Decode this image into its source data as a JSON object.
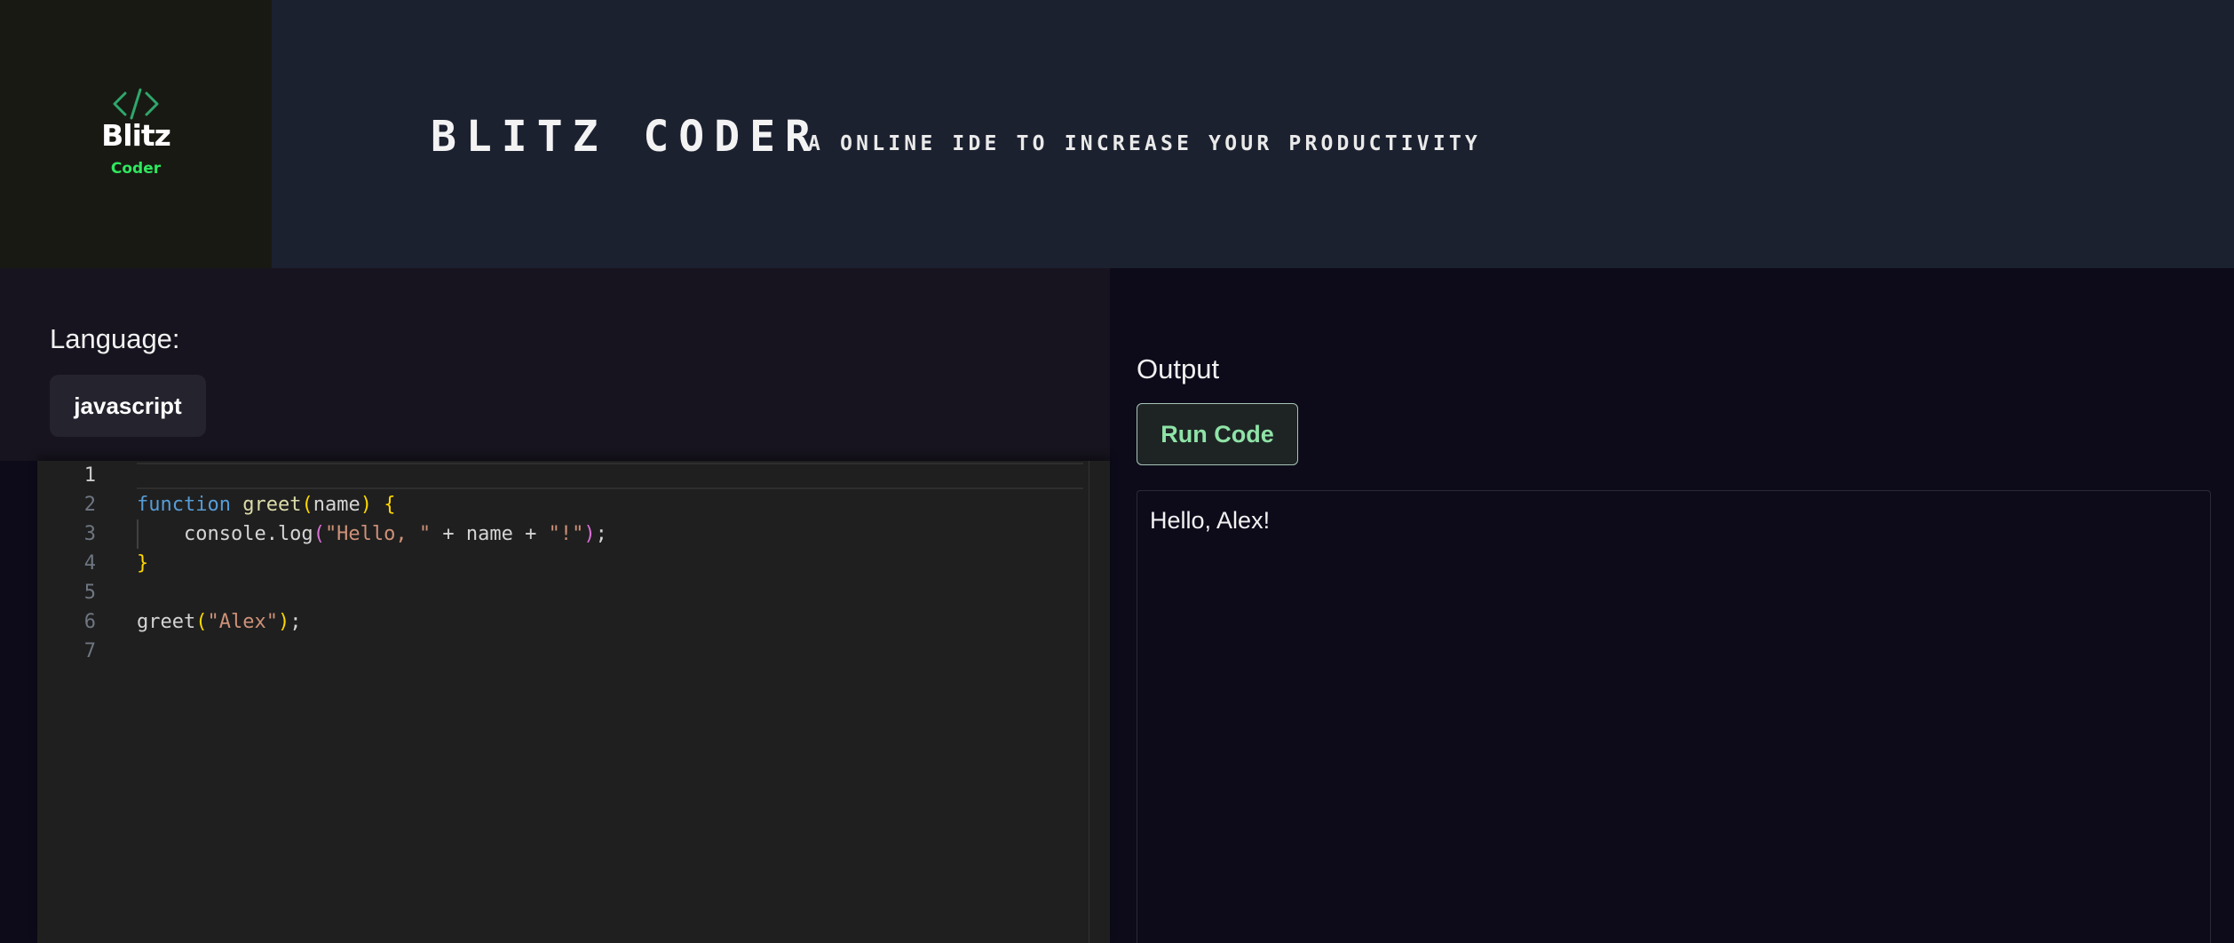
{
  "app": {
    "logo": {
      "glyph": "</>",
      "word": "Blitz",
      "sub": "Coder",
      "glyph_color": "#2ea76b",
      "sub_color": "#2ee85e"
    },
    "title": "BLITZ CODER",
    "tagline": "A ONLINE IDE TO INCREASE YOUR PRODUCTIVITY"
  },
  "language": {
    "label": "Language:",
    "selected": "javascript"
  },
  "editor": {
    "current_line": 1,
    "line_numbers": [
      "1",
      "2",
      "3",
      "4",
      "5",
      "6",
      "7"
    ],
    "lines": [
      [],
      [
        {
          "t": "function",
          "c": "kw"
        },
        {
          "t": " ",
          "c": "plain"
        },
        {
          "t": "greet",
          "c": "fn"
        },
        {
          "t": "(",
          "c": "br1"
        },
        {
          "t": "name",
          "c": "plain"
        },
        {
          "t": ")",
          "c": "br1"
        },
        {
          "t": " ",
          "c": "plain"
        },
        {
          "t": "{",
          "c": "br1"
        }
      ],
      [
        {
          "t": "    console.log",
          "c": "plain"
        },
        {
          "t": "(",
          "c": "br2"
        },
        {
          "t": "\"Hello, \"",
          "c": "str"
        },
        {
          "t": " + name + ",
          "c": "plain"
        },
        {
          "t": "\"!\"",
          "c": "str"
        },
        {
          "t": ")",
          "c": "br2"
        },
        {
          "t": ";",
          "c": "plain"
        }
      ],
      [
        {
          "t": "}",
          "c": "br1"
        }
      ],
      [],
      [
        {
          "t": "greet",
          "c": "plain"
        },
        {
          "t": "(",
          "c": "br1"
        },
        {
          "t": "\"Alex\"",
          "c": "str"
        },
        {
          "t": ")",
          "c": "br1"
        },
        {
          "t": ";",
          "c": "plain"
        }
      ],
      []
    ]
  },
  "output": {
    "title": "Output",
    "run_label": "Run Code",
    "result": "Hello, Alex!"
  }
}
